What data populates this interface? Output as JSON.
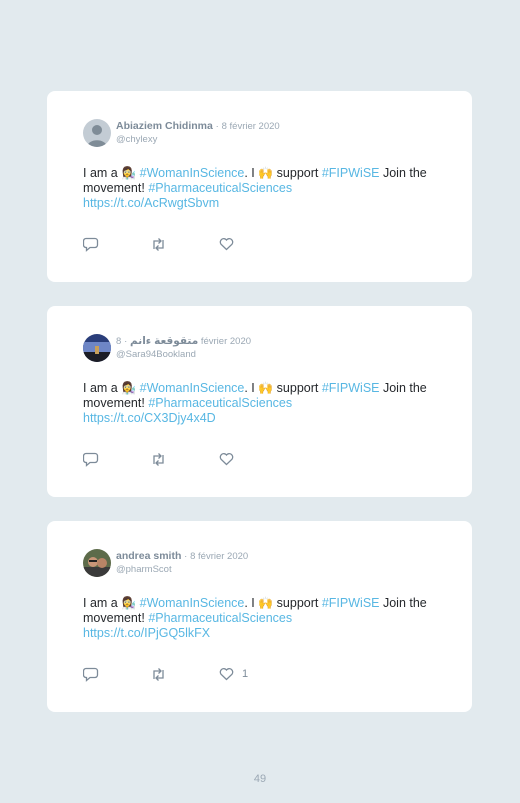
{
  "tweets": [
    {
      "name": "Abiaziem Chidinma",
      "separator": "·",
      "date": "8 février 2020",
      "handle": "@chylexy",
      "text": {
        "p1": "I am a ",
        "emoji1": "👩‍🔬",
        "tag1": "#WomanInScience",
        "p2": ". I ",
        "emoji2": "🙌",
        "p3": " support ",
        "tag2": "#FIPWiSE",
        "p4": " Join the movement! ",
        "tag3": "#PharmaceuticalSciences",
        "link": "https://t.co/AcRwgtSbvm"
      },
      "like_count": "",
      "avatar": "default-avatar"
    },
    {
      "name": "متقوقعة ءانم",
      "separator": "·",
      "date": "8 février 2020",
      "handle": "@Sara94Bookland",
      "text": {
        "p1": "I am a ",
        "emoji1": "👩‍🔬",
        "tag1": "#WomanInScience",
        "p2": ". I ",
        "emoji2": "🙌",
        "p3": " support ",
        "tag2": "#FIPWiSE",
        "p4": " Join the movement! ",
        "tag3": "#PharmaceuticalSciences",
        "link": "https://t.co/CX3Djy4x4D"
      },
      "like_count": "",
      "avatar": "landscape-photo"
    },
    {
      "name": "andrea smith",
      "separator": "·",
      "date": "8 février 2020",
      "handle": "@pharmScot",
      "text": {
        "p1": "I am a ",
        "emoji1": "👩‍🔬",
        "tag1": "#WomanInScience",
        "p2": ". I ",
        "emoji2": "🙌",
        "p3": " support ",
        "tag2": "#FIPWiSE",
        "p4": " Join the movement! ",
        "tag3": "#PharmaceuticalSciences",
        "link": "https://t.co/IPjGQ5lkFX"
      },
      "like_count": "1",
      "avatar": "people-photo"
    }
  ],
  "colors": {
    "background": "#e2eaee",
    "card": "#ffffff",
    "hashtag": "#58b7e3",
    "meta": "#9ba8b4"
  },
  "page_number": "49"
}
